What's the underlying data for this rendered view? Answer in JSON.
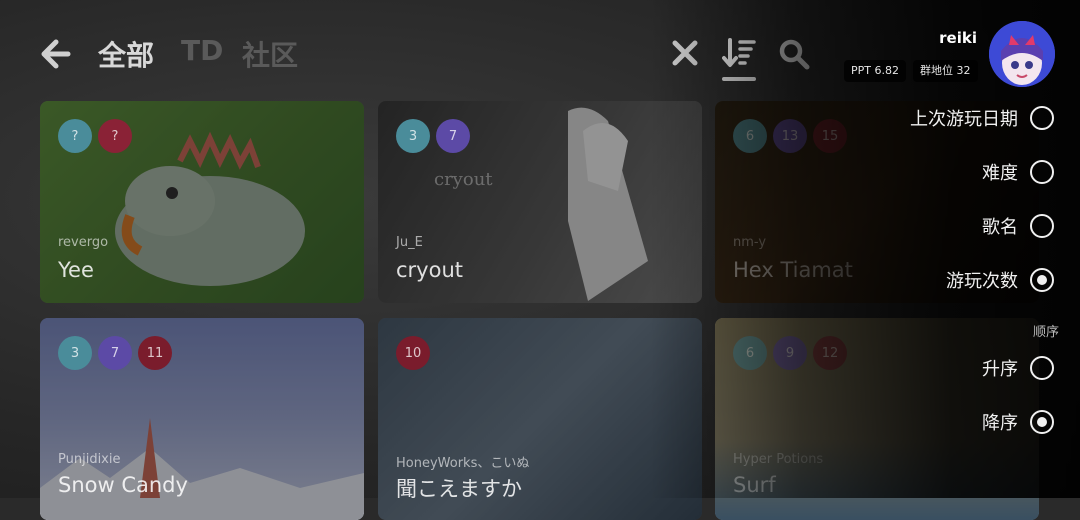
{
  "header": {
    "tabs": [
      {
        "label": "全部",
        "active": true
      },
      {
        "label": "TD",
        "active": false
      },
      {
        "label": "社区",
        "active": false
      }
    ],
    "icons": [
      "back-arrow-icon",
      "close-icon",
      "sort-icon",
      "search-icon"
    ]
  },
  "user": {
    "name": "reiki",
    "ppt": "PPT 6.82",
    "rank": "群地位 32"
  },
  "songs": [
    {
      "composer": "revergo",
      "title": "Yee",
      "levels": [
        "?",
        "?"
      ],
      "colors": [
        "#4a8c9a",
        "#8a2236"
      ]
    },
    {
      "composer": "Ju_E",
      "title": "cryout",
      "levels": [
        "3",
        "7"
      ],
      "colors": [
        "#4a8c9a",
        "#5c4aa6"
      ]
    },
    {
      "composer": "nm-y",
      "title": "Hex Tiamat",
      "levels": [
        "6",
        "13",
        "15"
      ],
      "colors": [
        "#4a8c9a",
        "#5c4aa6",
        "#7a1c2c"
      ]
    },
    {
      "composer": "Punjidixie",
      "title": "Snow Candy",
      "levels": [
        "3",
        "7",
        "11"
      ],
      "colors": [
        "#4a8c9a",
        "#5c4aa6",
        "#7a1c2c"
      ]
    },
    {
      "composer": "HoneyWorks、こいぬ",
      "title": "聞こえますか",
      "levels": [
        "10"
      ],
      "colors": [
        "#7a1c2c"
      ]
    },
    {
      "composer": "Hyper Potions",
      "title": "Surf",
      "levels": [
        "6",
        "9",
        "12"
      ],
      "colors": [
        "#4a8c9a",
        "#5c4aa6",
        "#7a1c2c"
      ]
    }
  ],
  "sort_options": [
    {
      "label": "上次游玩日期",
      "selected": false
    },
    {
      "label": "难度",
      "selected": false
    },
    {
      "label": "歌名",
      "selected": false
    },
    {
      "label": "游玩次数",
      "selected": true
    }
  ],
  "order": {
    "section_label": "顺序",
    "options": [
      {
        "label": "升序",
        "selected": false
      },
      {
        "label": "降序",
        "selected": true
      }
    ]
  }
}
